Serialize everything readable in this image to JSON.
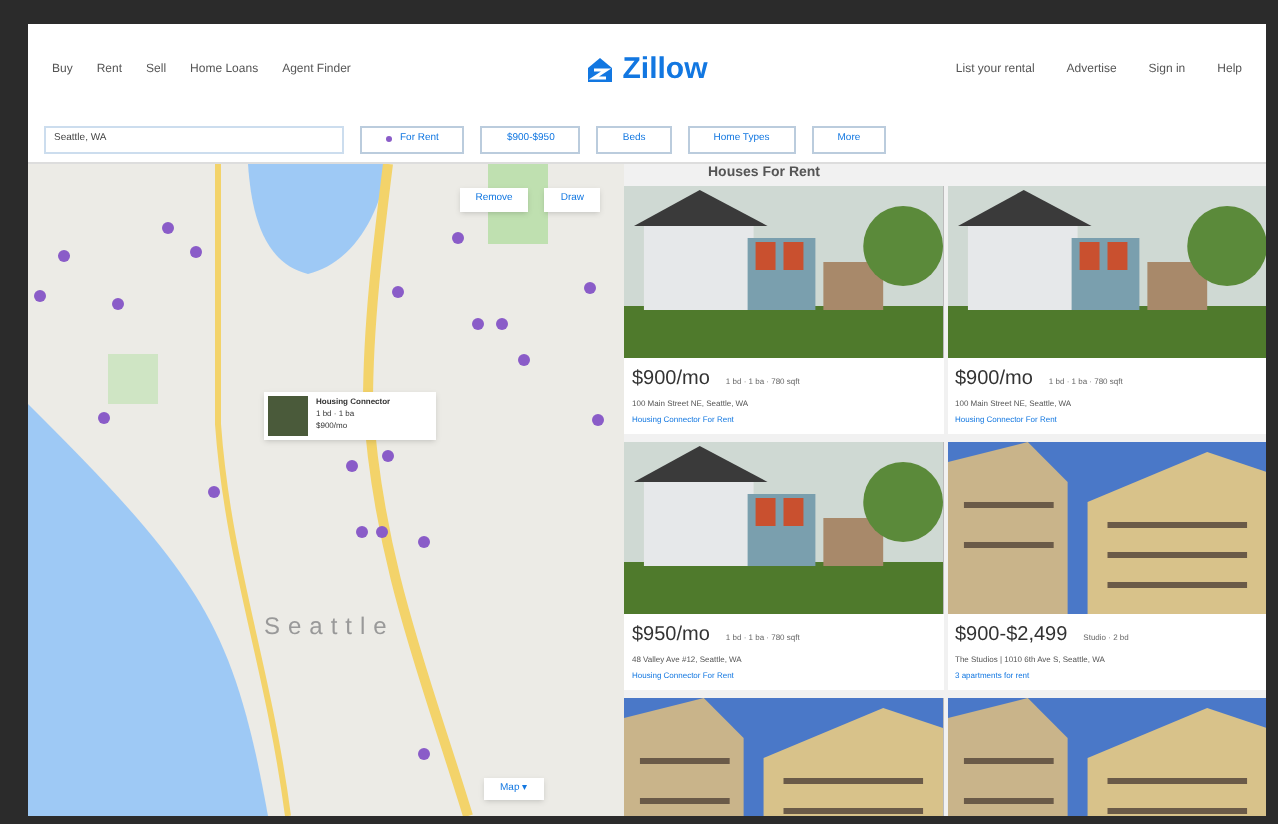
{
  "nav_left": [
    "Buy",
    "Rent",
    "Sell",
    "Home Loans",
    "Agent Finder"
  ],
  "logo": "Zillow",
  "nav_right": [
    "List your rental",
    "Advertise",
    "Sign in",
    "Help"
  ],
  "search": {
    "value": "Seattle, WA"
  },
  "filters": [
    {
      "label": "For Rent",
      "kind": "dot"
    },
    {
      "label": "$900-$950",
      "kind": "plain"
    },
    {
      "label": "Beds",
      "kind": "plain"
    },
    {
      "label": "Home Types",
      "kind": "plain"
    },
    {
      "label": "More",
      "kind": "plain"
    }
  ],
  "map": {
    "buttons": [
      "Remove",
      "Draw"
    ],
    "city_label": "Seattle",
    "popup": {
      "title": "Housing Connector",
      "details": "1 bd · 1 ba",
      "price": "$900/mo"
    },
    "map_button": "Map ▾"
  },
  "listings_title": "Houses For Rent",
  "listings": [
    {
      "kind": "house",
      "price": "$900/mo",
      "facts": "1 bd · 1 ba · 780 sqft",
      "address": "100 Main Street NE, Seattle, WA",
      "source": "Housing Connector For Rent"
    },
    {
      "kind": "house",
      "price": "$900/mo",
      "facts": "1 bd · 1 ba · 780 sqft",
      "address": "100 Main Street NE, Seattle, WA",
      "source": "Housing Connector For Rent"
    },
    {
      "kind": "house",
      "price": "$950/mo",
      "facts": "1 bd · 1 ba · 780 sqft",
      "address": "48 Valley Ave #12, Seattle, WA",
      "source": "Housing Connector For Rent"
    },
    {
      "kind": "apartment",
      "price": "$900-$2,499",
      "facts": "Studio · 2 bd",
      "address": "The Studios | 1010 6th Ave S, Seattle, WA",
      "source": "3 apartments for rent"
    },
    {
      "kind": "apartment"
    },
    {
      "kind": "apartment"
    }
  ]
}
